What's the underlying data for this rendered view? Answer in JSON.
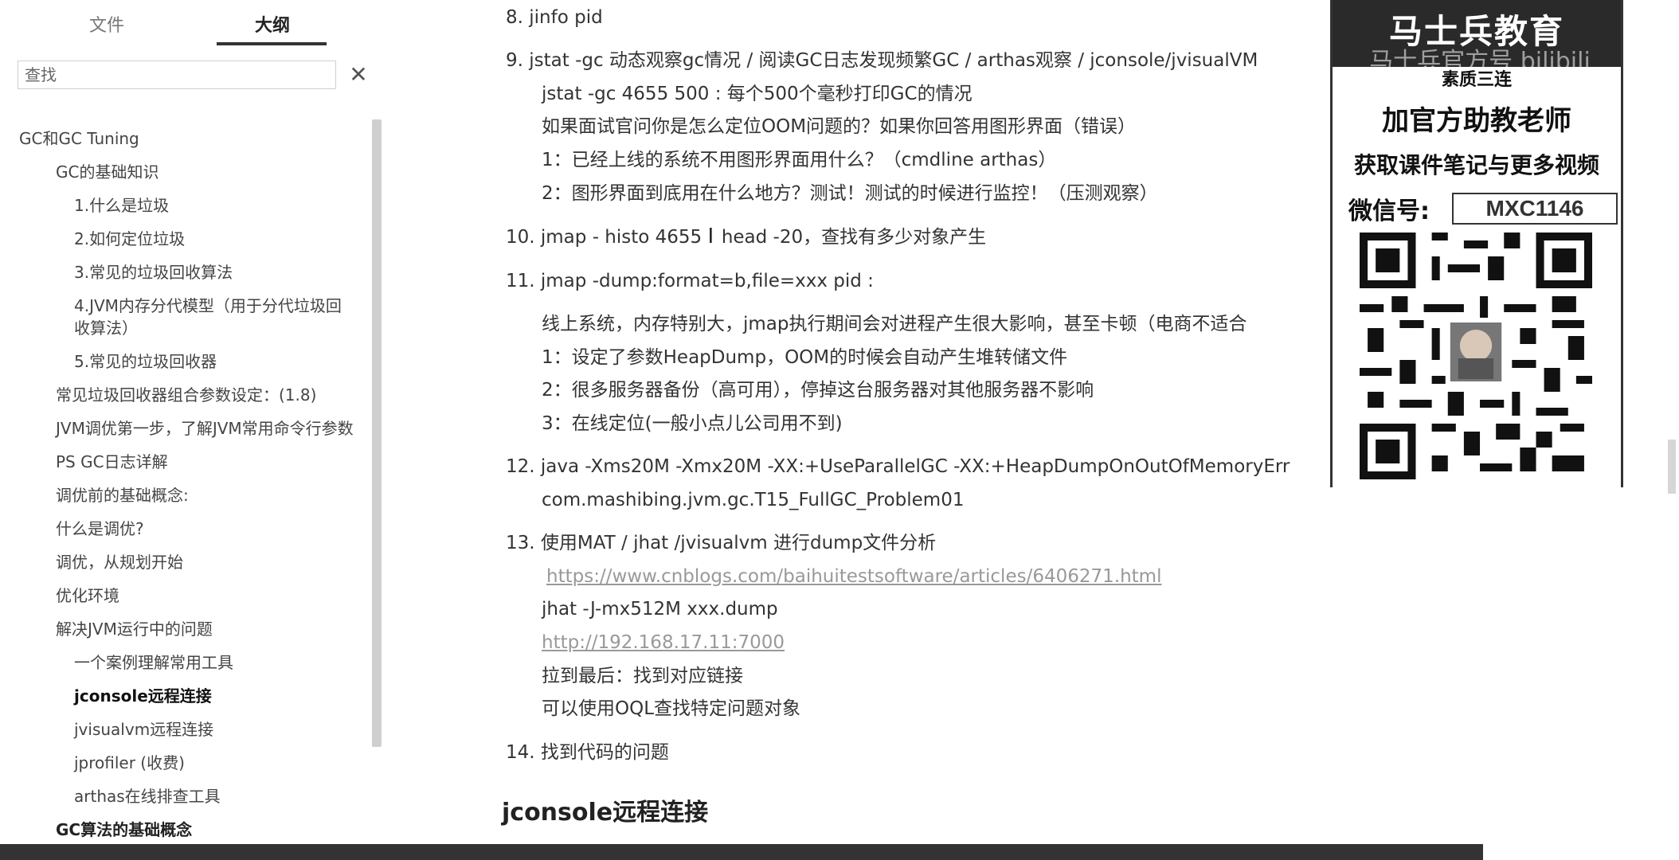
{
  "sidebar": {
    "tabs": {
      "files": "文件",
      "outline": "大纲"
    },
    "search": {
      "placeholder": "查找",
      "close": "✕"
    },
    "items": [
      {
        "label": "GC和GC Tuning"
      },
      {
        "label": "GC的基础知识"
      },
      {
        "label": "1.什么是垃圾"
      },
      {
        "label": "2.如何定位垃圾"
      },
      {
        "label": "3.常见的垃圾回收算法"
      },
      {
        "label": "4.JVM内存分代模型（用于分代垃圾回收算法）"
      },
      {
        "label": "5.常见的垃圾回收器"
      },
      {
        "label": "常见垃圾回收器组合参数设定：(1.8)"
      },
      {
        "label": "JVM调优第一步，了解JVM常用命令行参数"
      },
      {
        "label": "PS GC日志详解"
      },
      {
        "label": "调优前的基础概念:"
      },
      {
        "label": "什么是调优?"
      },
      {
        "label": "调优，从规划开始"
      },
      {
        "label": "优化环境"
      },
      {
        "label": "解决JVM运行中的问题"
      },
      {
        "label": "一个案例理解常用工具"
      },
      {
        "label": "jconsole远程连接"
      },
      {
        "label": "jvisualvm远程连接"
      },
      {
        "label": "jprofiler (收费)"
      },
      {
        "label": "arthas在线排查工具"
      },
      {
        "label": "GC算法的基础概念"
      }
    ]
  },
  "content": {
    "item8": "8. jinfo pid",
    "item9": "9. jstat -gc 动态观察gc情况 / 阅读GC日志发现频繁GC / arthas观察 / jconsole/jvisualVM",
    "item9_sub1": "jstat -gc 4655 500 : 每个500个毫秒打印GC的情况",
    "item9_sub2": "如果面试官问你是怎么定位OOM问题的？如果你回答用图形界面（错误）",
    "item9_sub3": "1：已经上线的系统不用图形界面用什么？（cmdline arthas）",
    "item9_sub4": "2：图形界面到底用在什么地方？测试！测试的时候进行监控！（压测观察）",
    "item10_a": "10. jmap - histo 4655",
    "item10_b": "head -20，查找有多少对象产生",
    "item11": "11. jmap -dump:format=b,file=xxx pid :",
    "item11_sub1": "线上系统，内存特别大，jmap执行期间会对进程产生很大影响，甚至卡顿（电商不适合",
    "item11_sub2": "1：设定了参数HeapDump，OOM的时候会自动产生堆转储文件",
    "item11_sub3": "2：很多服务器备份（高可用），停掉这台服务器对其他服务器不影响",
    "item11_sub4": "3：在线定位(一般小点儿公司用不到)",
    "item12": "12. java -Xms20M -Xmx20M -XX:+UseParallelGC -XX:+HeapDumpOnOutOfMemoryErr",
    "item12_sub1": "com.mashibing.jvm.gc.T15_FullGC_Problem01",
    "item13": "13. 使用MAT / jhat /jvisualvm 进行dump文件分析",
    "item13_link1": "https://www.cnblogs.com/baihuitestsoftware/articles/6406271.html",
    "item13_sub1": "jhat -J-mx512M xxx.dump",
    "item13_link2": "http://192.168.17.11:7000",
    "item13_sub2": "拉到最后：找到对应链接",
    "item13_sub3": "可以使用OQL查找特定问题对象",
    "item14": "14. 找到代码的问题",
    "section_heading": "jconsole远程连接",
    "cursor_glyph": "I"
  },
  "promo": {
    "brand": "马士兵教育",
    "brand_ghost": "马士兵官方号 bilibili",
    "tag": "素质三连",
    "line1": "加官方助教老师",
    "line2": "获取课件笔记与更多视频",
    "wechat_label": "微信号:",
    "wechat_id": "MXC1146"
  },
  "colors": {
    "accent": "#333333",
    "link": "#999999",
    "panel_dark": "#2a2a2a"
  }
}
